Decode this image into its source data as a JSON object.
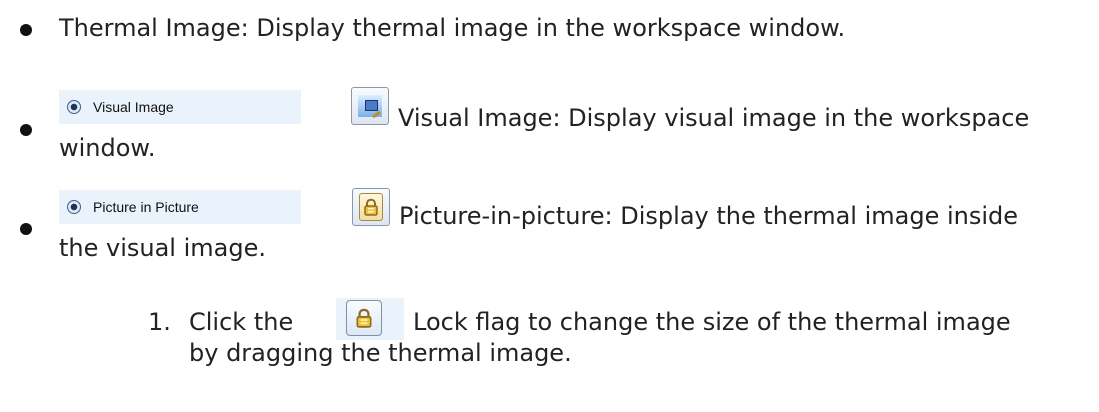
{
  "items": [
    {
      "text": "Thermal Image: Display thermal image in the workspace window."
    },
    {
      "radio_label": "Visual Image",
      "text_line1": "Visual Image: Display visual image in the workspace",
      "text_line2": "window."
    },
    {
      "radio_label": "Picture in Picture",
      "text_line1": "Picture-in-picture: Display the thermal image inside",
      "text_line2": "the visual image."
    }
  ],
  "numbered": {
    "number": "1.",
    "before_icon": "Click the",
    "after_icon": "Lock flag to change the size of the thermal image",
    "line2": "by dragging the thermal image."
  },
  "colors": {
    "highlight": "#eaf2fb",
    "text": "#222222"
  },
  "icons": {
    "visual_button": "visual-image-icon",
    "lock_button": "lock-icon"
  }
}
